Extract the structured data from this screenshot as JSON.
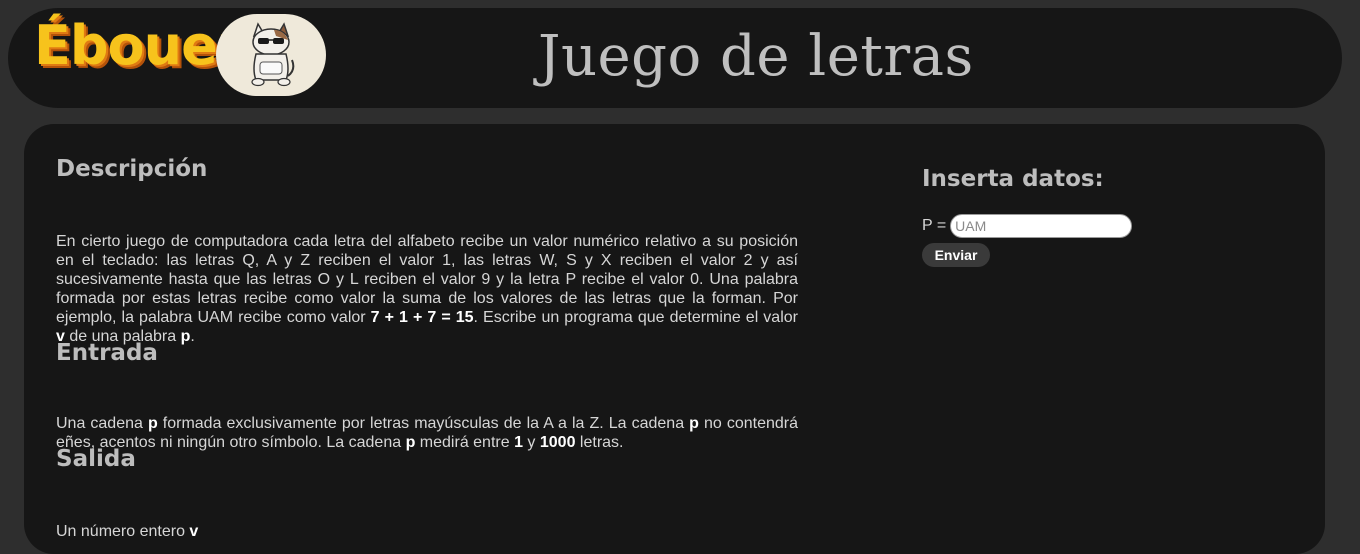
{
  "header": {
    "logo_text": "Éboueur",
    "title": "Juego de letras"
  },
  "description": {
    "title": "Descripción",
    "body_html": "En cierto juego de computadora cada letra del alfabeto recibe un valor numérico relativo a su posición en el teclado: las letras Q, A y Z reciben el valor 1, las letras W, S y X reciben el valor 2 y así sucesivamente hasta que las letras O y L reciben el valor 9 y la letra P recibe el valor 0. Una palabra formada por estas letras recibe como valor la suma de los valores de las letras que la forman. Por ejemplo, la palabra UAM recibe como valor <b>7 + 1 + 7 = 15</b>. Escribe un programa que determine el valor <b>v</b> de una palabra <b>p</b>."
  },
  "input_section": {
    "title": "Entrada",
    "body_html": "Una cadena <b>p</b> formada exclusivamente por letras mayúsculas de la A a la Z. La cadena <b>p</b> no contendrá eñes, acentos ni ningún otro símbolo. La cadena <b>p</b> medirá entre <b>1</b> y <b>1000</b> letras."
  },
  "output_section": {
    "title": "Salida",
    "body_html": "Un número entero <b>v</b>"
  },
  "form": {
    "title": "Inserta datos:",
    "field_label": "P =",
    "field_placeholder": "UAM",
    "field_value": "",
    "submit_label": "Enviar"
  }
}
